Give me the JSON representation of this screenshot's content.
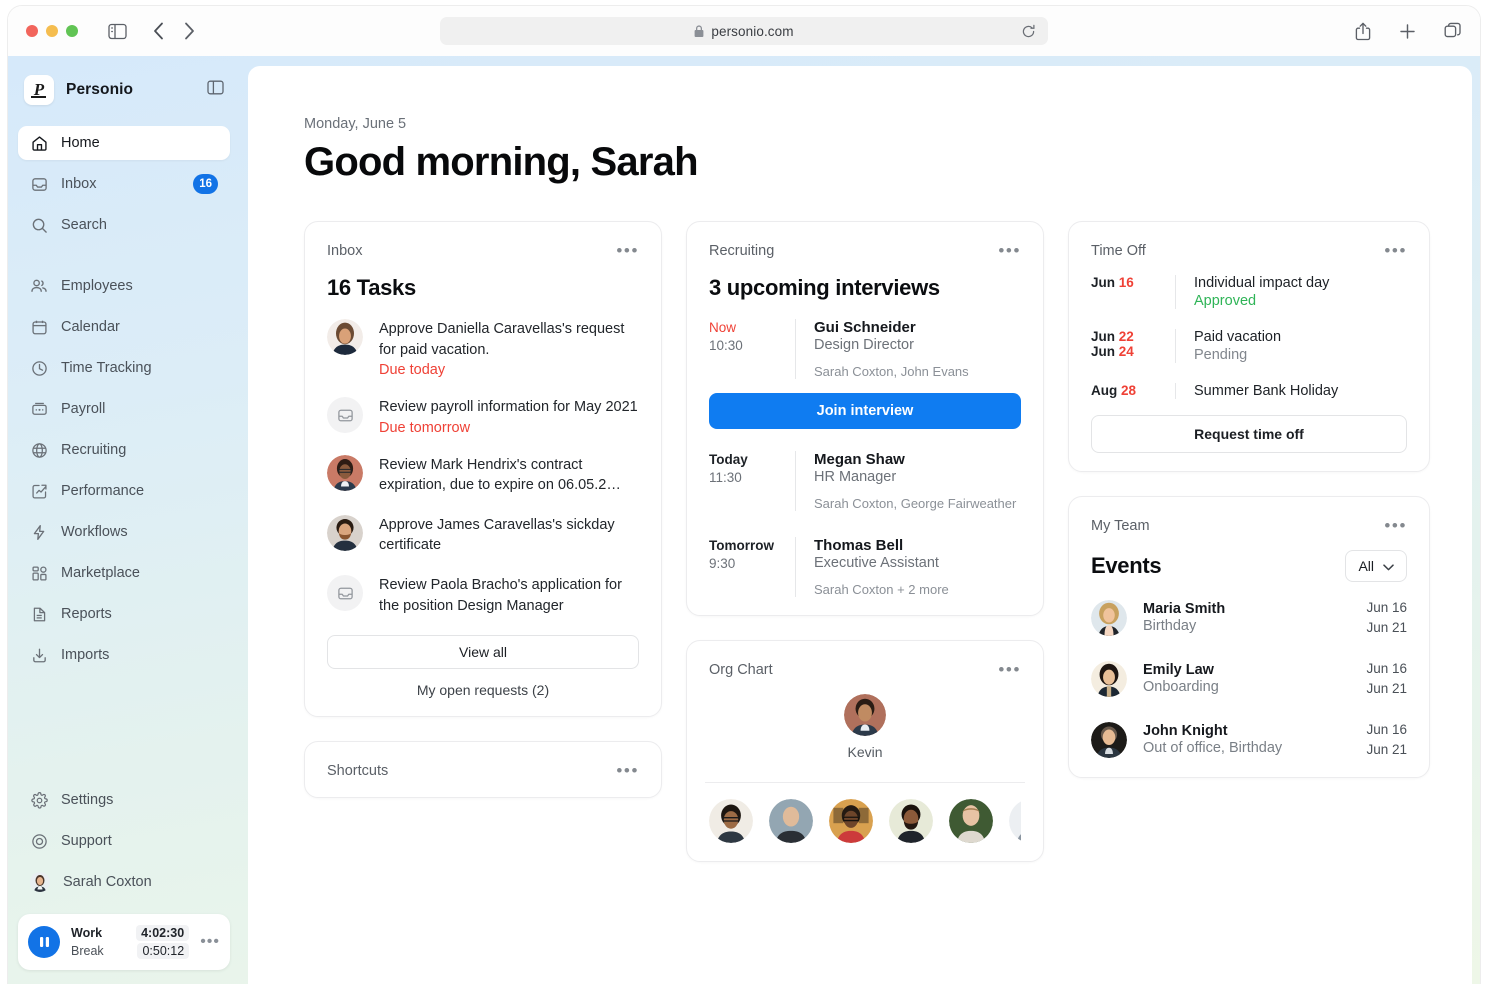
{
  "browser": {
    "url": "personio.com",
    "lock_icon": "lock-icon",
    "reload_icon": "reload-icon",
    "back_icon": "chevron-left-icon",
    "forward_icon": "chevron-right-icon",
    "sidebar_icon": "sidebar-toggle-icon",
    "share_icon": "share-icon",
    "new_tab_icon": "plus-icon",
    "tabs_icon": "tabs-overview-icon"
  },
  "sidebar": {
    "brand": "Personio",
    "panel_icon": "panel-collapse-icon",
    "items": [
      {
        "label": "Home",
        "icon": "home-icon",
        "active": true
      },
      {
        "label": "Inbox",
        "icon": "inbox-icon",
        "badge": "16"
      },
      {
        "label": "Search",
        "icon": "search-icon"
      },
      {
        "label": "Employees",
        "icon": "employees-icon"
      },
      {
        "label": "Calendar",
        "icon": "calendar-icon"
      },
      {
        "label": "Time Tracking",
        "icon": "clock-icon"
      },
      {
        "label": "Payroll",
        "icon": "payroll-icon"
      },
      {
        "label": "Recruiting",
        "icon": "globe-icon"
      },
      {
        "label": "Performance",
        "icon": "performance-icon"
      },
      {
        "label": "Workflows",
        "icon": "lightning-icon"
      },
      {
        "label": "Marketplace",
        "icon": "marketplace-icon"
      },
      {
        "label": "Reports",
        "icon": "document-icon"
      },
      {
        "label": "Imports",
        "icon": "import-icon"
      }
    ],
    "bottom_items": [
      {
        "label": "Settings",
        "icon": "gear-icon"
      },
      {
        "label": "Support",
        "icon": "lifebuoy-icon"
      },
      {
        "label": "Sarah Coxton",
        "icon": "user-avatar"
      }
    ],
    "timer": {
      "pause_icon": "pause-icon",
      "work_label": "Work",
      "work_value": "4:02:30",
      "break_label": "Break",
      "break_value": "0:50:12",
      "more_icon": "more-icon"
    }
  },
  "header": {
    "date": "Monday, June 5",
    "greeting": "Good morning, Sarah"
  },
  "inbox_card": {
    "title": "Inbox",
    "more_icon": "more-icon",
    "heading": "16 Tasks",
    "tasks": [
      {
        "text": "Approve Daniella Caravellas's request for paid vacation.",
        "due": "Due today",
        "avatar": "avatar-daniella"
      },
      {
        "text": "Review payroll information for May 2021",
        "due": "Due tomorrow",
        "avatar": "placeholder-inbox-icon"
      },
      {
        "text": "Review Mark Hendrix's contract expiration, due to expire on 06.05.2…",
        "due": "",
        "avatar": "avatar-mark"
      },
      {
        "text": "Approve James Caravellas's sickday certificate",
        "due": "",
        "avatar": "avatar-james"
      },
      {
        "text": "Review Paola Bracho's application for the position Design Manager",
        "due": "",
        "avatar": "placeholder-inbox-icon"
      }
    ],
    "view_all": "View all",
    "open_requests": "My open requests (2)"
  },
  "shortcuts_card": {
    "title": "Shortcuts",
    "more_icon": "more-icon"
  },
  "recruiting_card": {
    "title": "Recruiting",
    "more_icon": "more-icon",
    "heading": "3 upcoming interviews",
    "join_button": "Join interview",
    "interviews": [
      {
        "when": "Now",
        "when_style": "now",
        "time": "10:30",
        "name": "Gui Schneider",
        "role": "Design Director",
        "people": "Sarah Coxton, John Evans"
      },
      {
        "when": "Today",
        "when_style": "day",
        "time": "11:30",
        "name": "Megan Shaw",
        "role": "HR Manager",
        "people": "Sarah Coxton, George Fairweather"
      },
      {
        "when": "Tomorrow",
        "when_style": "day",
        "time": "9:30",
        "name": "Thomas Bell",
        "role": "Executive Assistant",
        "people": "Sarah Coxton + 2 more"
      }
    ]
  },
  "org_chart_card": {
    "title": "Org Chart",
    "more_icon": "more-icon",
    "root_name": "Kevin",
    "root_avatar": "avatar-kevin",
    "reports": [
      "avatar-1",
      "avatar-2",
      "avatar-3",
      "avatar-4",
      "avatar-5",
      "avatar-6"
    ]
  },
  "time_off_card": {
    "title": "Time Off",
    "more_icon": "more-icon",
    "request_button": "Request time off",
    "entries": [
      {
        "month1": "Jun",
        "day1": "16",
        "month2": "",
        "day2": "",
        "title": "Individual impact day",
        "status": "Approved",
        "status_style": "approved"
      },
      {
        "month1": "Jun",
        "day1": "22",
        "month2": "Jun",
        "day2": "24",
        "title": "Paid vacation",
        "status": "Pending",
        "status_style": "pending"
      },
      {
        "month1": "Aug",
        "day1": "28",
        "month2": "",
        "day2": "",
        "title": "Summer Bank Holiday",
        "status": "",
        "status_style": ""
      }
    ]
  },
  "my_team_card": {
    "title": "My Team",
    "more_icon": "more-icon",
    "events_heading": "Events",
    "filter_value": "All",
    "filter_icon": "chevron-down-icon",
    "events": [
      {
        "name": "Maria Smith",
        "sub": "Birthday",
        "date1": "Jun 16",
        "date2": "Jun 21",
        "avatar": "avatar-maria"
      },
      {
        "name": "Emily Law",
        "sub": "Onboarding",
        "date1": "Jun 16",
        "date2": "Jun 21",
        "avatar": "avatar-emily"
      },
      {
        "name": "John Knight",
        "sub": "Out of office, Birthday",
        "date1": "Jun 16",
        "date2": "Jun 21",
        "avatar": "avatar-john"
      }
    ]
  },
  "colors": {
    "accent": "#1273e6",
    "primary_button": "#0f7cf1",
    "danger": "#ef4136",
    "success": "#2fb457"
  }
}
